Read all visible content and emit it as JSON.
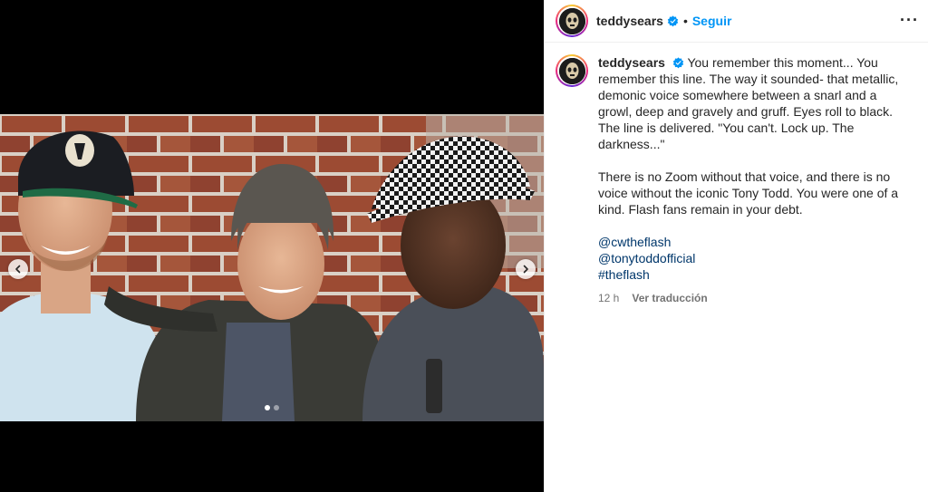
{
  "post": {
    "username": "teddysears",
    "follow_label": "Seguir",
    "separator": "•",
    "more_label": "···",
    "caption_p1": "You remember this moment... You remember this line. The way it sounded- that metallic, demonic voice somewhere between a snarl and a growl, deep and gravely and gruff. Eyes roll to black. The line is delivered. \"You can't. Lock up. The darkness...\"",
    "caption_p2": "There is no Zoom without that voice, and there is no voice without the iconic Tony Todd. You were one of a kind. Flash fans remain in your debt.",
    "tags": [
      "@cwtheflash",
      "@tonytoddofficial",
      "#theflash"
    ],
    "time_ago": "12 h",
    "translate_label": "Ver traducción"
  },
  "carousel": {
    "total_slides": 2,
    "active_slide": 1
  },
  "icons": {
    "verified": "verified-badge-icon",
    "prev": "chevron-left-icon",
    "next": "chevron-right-icon",
    "more": "more-options-icon"
  },
  "colors": {
    "follow_blue": "#0095f6",
    "verified_blue": "#0095f6",
    "link_blue": "#00376b",
    "meta_gray": "#737373",
    "media_bg": "#000000"
  }
}
